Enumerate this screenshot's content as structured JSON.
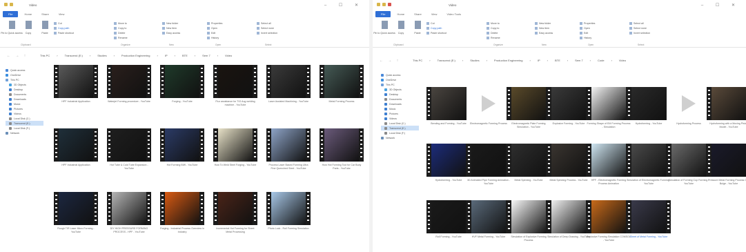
{
  "left_window": {
    "title": "Video",
    "tabs": [
      "File",
      "Home",
      "Share",
      "View"
    ],
    "ribbon": {
      "pin_label": "Pin to Quick access",
      "copy_label": "Copy",
      "paste_label": "Paste",
      "cut_label": "Cut",
      "copy_path_label": "Copy path",
      "paste_shortcut_label": "Paste shortcut",
      "move_to_label": "Move to",
      "copy_to_label": "Copy to",
      "delete_label": "Delete",
      "rename_label": "Rename",
      "new_folder_label": "New folder",
      "new_item_label": "New item",
      "easy_access_label": "Easy access",
      "properties_label": "Properties",
      "open_label": "Open",
      "edit_label": "Edit",
      "history_label": "History",
      "select_all_label": "Select all",
      "select_none_label": "Select none",
      "invert_selection_label": "Invert selection",
      "group_clipboard": "Clipboard",
      "group_organize": "Organize",
      "group_new": "New",
      "group_open": "Open",
      "group_select": "Select"
    },
    "breadcrumb": [
      "This PC",
      "Transcend (E:)",
      "Studies",
      "Production Engineering",
      "IP",
      "BTE",
      "Sem 7",
      "Video"
    ],
    "sidebar": [
      {
        "label": "Quick access",
        "color": "#4a88d8",
        "indent": false
      },
      {
        "label": "OneDrive",
        "color": "#3b8fe0",
        "indent": false
      },
      {
        "label": "This PC",
        "color": "#6f9fd8",
        "indent": false
      },
      {
        "label": "3D Objects",
        "color": "#4aa3df",
        "indent": true
      },
      {
        "label": "Desktop",
        "color": "#3d7fd1",
        "indent": true
      },
      {
        "label": "Documents",
        "color": "#8a8a8a",
        "indent": true
      },
      {
        "label": "Downloads",
        "color": "#3d7fd1",
        "indent": true
      },
      {
        "label": "Music",
        "color": "#3d7fd1",
        "indent": true
      },
      {
        "label": "Pictures",
        "color": "#3d7fd1",
        "indent": true
      },
      {
        "label": "Videos",
        "color": "#3d7fd1",
        "indent": true
      },
      {
        "label": "Local Disk (C:)",
        "color": "#8a8a8a",
        "indent": true
      },
      {
        "label": "Transcend (E:)",
        "color": "#8a8a8a",
        "indent": true,
        "selected": true
      },
      {
        "label": "Local Disk (F:)",
        "color": "#8a8a8a",
        "indent": true
      },
      {
        "label": "Network",
        "color": "#6a8fb8",
        "indent": false
      }
    ],
    "files": [
      {
        "name": "HPF Industrial Application",
        "bg": "#5a5a5a"
      },
      {
        "name": "Waterjet Forming procedure - YouTube",
        "bg": "#2a1f1c"
      },
      {
        "name": "Forging - YouTube",
        "bg": "#1f3a2a"
      },
      {
        "name": "Flux assistance for TIG Aug welding machine - YouTube",
        "bg": "#1a1410"
      },
      {
        "name": "Laser Assisted Machining - YouTube",
        "bg": "#3a3a3a"
      },
      {
        "name": "Metal Forming Process",
        "bg": "#455a55"
      },
      {
        "name": "HPF Industrial Application",
        "bg": "#1f2f3a"
      },
      {
        "name": "Hot Tube & Cold Tube Expansion - YouTube",
        "bg": "#1e1e1e"
      },
      {
        "name": "Hot Forming BIW - YouTube",
        "bg": "#2b3b66"
      },
      {
        "name": "How To Weld Steel Forging - YouTube",
        "bg": "#e8e2c8"
      },
      {
        "name": "Process Laser Based Forming Ultra Fine Quenched Steel - YouTube",
        "bg": "#8ea4c8"
      },
      {
        "name": "How Hot Forming Tool for Car Body Parts - YouTube",
        "bg": "#6a5a7a"
      },
      {
        "name": "Rough TIR Laser Micro Forming - YouTube",
        "bg": "#1c2740"
      },
      {
        "name": "DIY HIGH PRESSURE FORMING PROCESS - HPF - YouTube",
        "bg": "#b5b5b5"
      },
      {
        "name": "Forging - Industrial Process Overview in Industry",
        "bg": "#d85a12"
      },
      {
        "name": "Incremental Hot Forming for Sheet Metal Processing",
        "bg": "#4a2418"
      },
      {
        "name": "Photo Lock - Roll Forming Simulation",
        "bg": "#a8c8e8"
      }
    ]
  },
  "right_window": {
    "title": "Video",
    "tabs": [
      "File",
      "Home",
      "Share",
      "View",
      "Video Tools"
    ],
    "breadcrumb": [
      "This PC",
      "Transcend (E:)",
      "Studies",
      "Production Engineering",
      "IP",
      "BTE",
      "Sem 7",
      "Code",
      "Video"
    ],
    "sidebar": [
      {
        "label": "Quick access",
        "color": "#4a88d8",
        "indent": false
      },
      {
        "label": "OneDrive",
        "color": "#3b8fe0",
        "indent": false
      },
      {
        "label": "This PC",
        "color": "#6f9fd8",
        "indent": false
      },
      {
        "label": "3D Objects",
        "color": "#4aa3df",
        "indent": true
      },
      {
        "label": "Desktop",
        "color": "#3d7fd1",
        "indent": true
      },
      {
        "label": "Documents",
        "color": "#8a8a8a",
        "indent": true
      },
      {
        "label": "Downloads",
        "color": "#3d7fd1",
        "indent": true
      },
      {
        "label": "Music",
        "color": "#3d7fd1",
        "indent": true
      },
      {
        "label": "Pictures",
        "color": "#3d7fd1",
        "indent": true
      },
      {
        "label": "Videos",
        "color": "#3d7fd1",
        "indent": true
      },
      {
        "label": "Local Disk (C:)",
        "color": "#8a8a8a",
        "indent": true
      },
      {
        "label": "Transcend (E:)",
        "color": "#8a8a8a",
        "indent": true,
        "selected": true
      },
      {
        "label": "Local Disk (F:)",
        "color": "#8a8a8a",
        "indent": true
      },
      {
        "label": "Network",
        "color": "#6a8fb8",
        "indent": false
      }
    ],
    "files": [
      {
        "name": "Bending and Forming - YouTube",
        "bg": "#4a4540"
      },
      {
        "name": "Electromagnetic Forming Process",
        "bg": "play"
      },
      {
        "name": "Electromagnetic Plate Forming Simulation - YouTube",
        "bg": "#5a4a2a"
      },
      {
        "name": "Explosive Forming - YouTube",
        "bg": "#3a3a3a"
      },
      {
        "name": "Forming Shape of EM Forming Process - Simulation",
        "bg": "#f4f4f4"
      },
      {
        "name": "Hydroforming - YouTube",
        "bg": "#2a2a2a"
      },
      {
        "name": "Hydroforming Process",
        "bg": "play"
      },
      {
        "name": "Hydroforming with a Moving Piston Model - YouTube",
        "bg": "#5a4a3a"
      },
      {
        "name": "Hydroforming - YouTube",
        "bg": "#1c2c7a"
      },
      {
        "name": "3D Animated Pipe Forming Animation - YouTube",
        "bg": "#1a1a1a"
      },
      {
        "name": "Metal Spinning - YouTube",
        "bg": "#2e2e2e"
      },
      {
        "name": "Metal Spinning Process - YouTube",
        "bg": "#3a3530"
      },
      {
        "name": "HPF - Electromagnetic Forming Process Animation",
        "bg": "#cfe6f2"
      },
      {
        "name": "Simulation of Electromagnetic Forming - YouTube",
        "bg": "#4a4a4a"
      },
      {
        "name": "Simulation of Forming Cup Forming - YouTube",
        "bg": "#6a6a6a"
      },
      {
        "name": "Pressure Metal Forming Process Gas Bulge - YouTube",
        "bg": "#1a1a2a"
      },
      {
        "name": "Roll Forming - YouTube",
        "bg": "#1a1a1a"
      },
      {
        "name": "HVF Metal Forming - YouTube",
        "bg": "#5a6a7a"
      },
      {
        "name": "Simulation of Explosive Forming Process",
        "bg": "#f8f8f8"
      },
      {
        "name": "Simulation of Deep Drawing - YouTube",
        "bg": "#f0f0f0"
      },
      {
        "name": "Explosive Forming Simulation COMSOL - YouTube",
        "bg": "#c86a1a"
      },
      {
        "name": "Sheet of Metal Forming - YouTube",
        "bg": "#3a3a4a",
        "selected": true
      }
    ]
  }
}
